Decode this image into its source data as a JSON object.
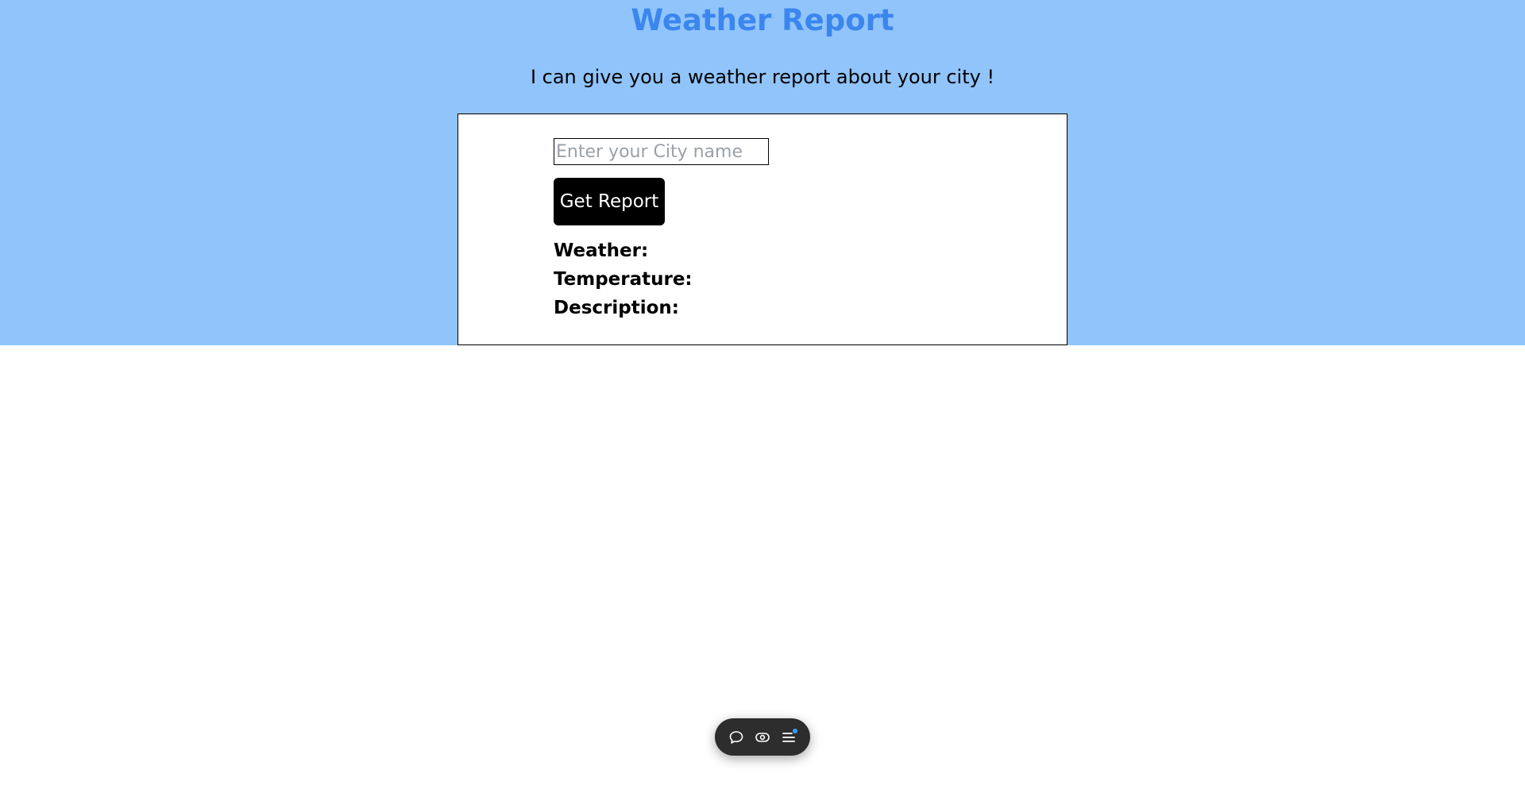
{
  "header": {
    "title": "Weather Report",
    "subtitle": "I can give you a weather report about your city !"
  },
  "form": {
    "city_placeholder": "Enter your City name",
    "city_value": "",
    "submit_label": "Get Report"
  },
  "results": {
    "weather_label": "Weather:",
    "temperature_label": "Temperature:",
    "description_label": "Description:"
  },
  "toolbar": {
    "icons": [
      "chat-icon",
      "eye-toggle-icon",
      "menu-icon"
    ],
    "notification_color": "#3b9cff"
  },
  "colors": {
    "band": "#90c4fb",
    "title": "#3b86ee",
    "button": "#000000"
  }
}
